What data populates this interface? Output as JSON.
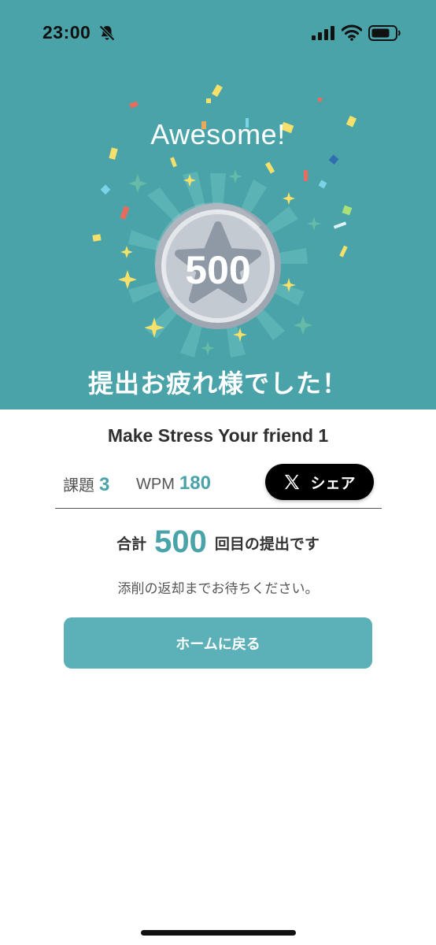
{
  "status_bar": {
    "time": "23:00",
    "icons": [
      "bell-slash-icon",
      "signal-icon",
      "wifi-icon",
      "battery-icon"
    ]
  },
  "hero": {
    "exclamation": "Awesome!",
    "medal_number": "500",
    "title": "提出お疲れ様でした！",
    "background_color": "#4aa3a8"
  },
  "submission": {
    "title": "Make Stress Your friend 1",
    "assignment_label": "課題",
    "assignment_value": "3",
    "wpm_label": "WPM",
    "wpm_value": "180",
    "share_label": "シェア",
    "share_icon": "x-logo-icon",
    "total_prefix": "合計",
    "total_count": "500",
    "total_suffix": "回目の提出です",
    "wait_message": "添削の返却までお待ちください。",
    "home_button": "ホームに戻る",
    "accent_color": "#4aa3a8"
  }
}
